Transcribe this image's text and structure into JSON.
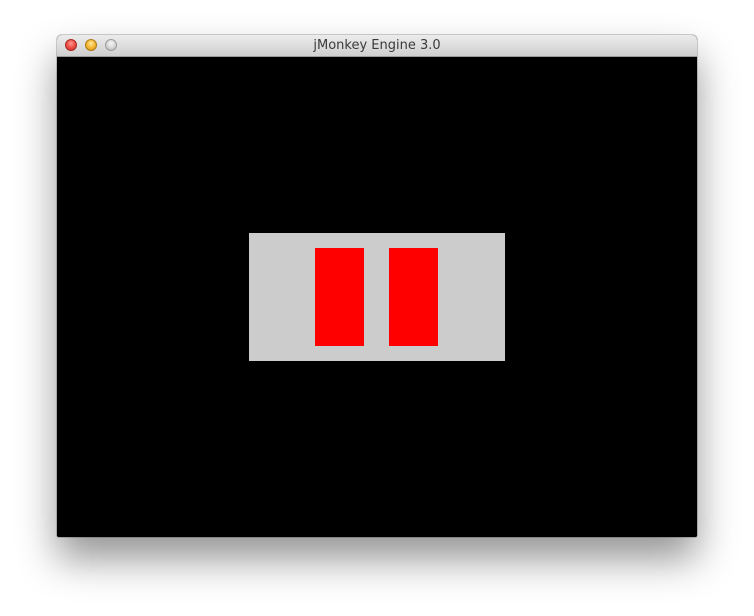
{
  "window": {
    "title": "jMonkey Engine 3.0",
    "buttons": [
      "close",
      "minimize",
      "zoom"
    ]
  },
  "scene": {
    "background_color": "#000000",
    "panel_color": "#cccccc",
    "block_color": "#ff0000",
    "block_count": 2
  }
}
